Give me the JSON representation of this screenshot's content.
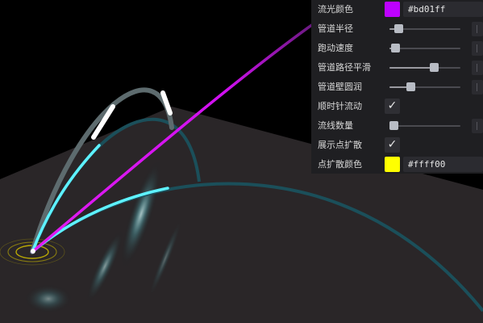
{
  "gui": {
    "flow_color": {
      "label": "流光颜色",
      "value": "#bd01ff",
      "swatch": "#bd01ff"
    },
    "pipe_radius": {
      "label": "管道半径",
      "level": 0.08
    },
    "run_speed": {
      "label": "跑动速度",
      "level": 0.02
    },
    "path_smooth": {
      "label": "管道路径平滑",
      "level": 0.65
    },
    "wall_round": {
      "label": "管道壁圆润",
      "level": 0.27
    },
    "clockwise": {
      "label": "顺时针流动",
      "checked": true,
      "check_glyph": "✓"
    },
    "flow_count": {
      "label": "流线数量",
      "level": 0.0
    },
    "show_spread": {
      "label": "展示点扩散",
      "checked": true,
      "check_glyph": "✓"
    },
    "spread_color": {
      "label": "点扩散颜色",
      "value": "#ffff00",
      "swatch": "#ffff00"
    }
  },
  "scene": {
    "background": "#000000",
    "ground": "#2a2628",
    "pipe_color": "#1b4f5a",
    "arc_grey": "#5d6b6e",
    "flow_magenta": "#e21cf2",
    "flow_cyan": "#5ef2ff",
    "ripple_color": "#c9b700"
  }
}
